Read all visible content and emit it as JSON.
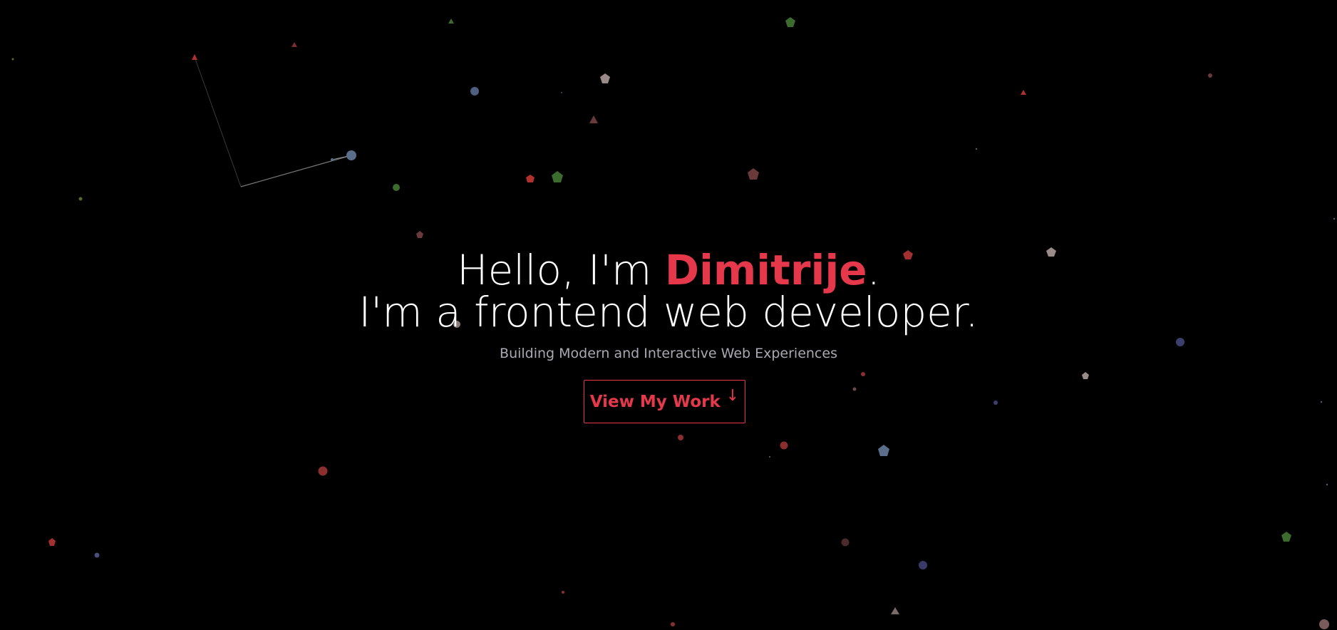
{
  "hero": {
    "greeting_prefix": "Hello, I'm ",
    "name": "Dimitrije",
    "greeting_suffix": ".",
    "role_line": "I'm a frontend web developer.",
    "tagline": "Building Modern and Interactive Web Experiences",
    "cta_label": "View My Work",
    "cta_arrow": "↓"
  },
  "colors": {
    "background": "#000000",
    "accent": "#e5384a",
    "text": "#ffffff",
    "subtle_text": "#a9a9b3"
  },
  "icons": {
    "cta_arrow": "arrow-down-icon"
  }
}
